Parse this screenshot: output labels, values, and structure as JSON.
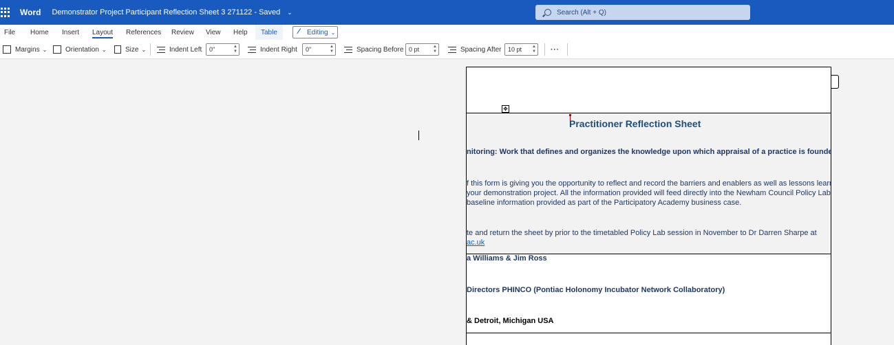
{
  "titlebar": {
    "app_name": "Word",
    "document_title": "Demonstrator Project Participant Reflection Sheet 3 271122",
    "save_status": "Saved",
    "search_placeholder": "Search (Alt + Q)"
  },
  "tabs": [
    {
      "label": "File"
    },
    {
      "label": "Home"
    },
    {
      "label": "Insert"
    },
    {
      "label": "Layout",
      "active": true
    },
    {
      "label": "References"
    },
    {
      "label": "Review"
    },
    {
      "label": "View"
    },
    {
      "label": "Help"
    },
    {
      "label": "Table",
      "contextual": true
    }
  ],
  "mode_button": {
    "label": "Editing"
  },
  "toolbar": {
    "margins_label": "Margins",
    "orientation_label": "Orientation",
    "size_label": "Size",
    "indent_left_label": "Indent Left",
    "indent_left_value": "0\"",
    "indent_right_label": "Indent Right",
    "indent_right_value": "0\"",
    "spacing_before_label": "Spacing Before",
    "spacing_before_value": "0 pt",
    "spacing_after_label": "Spacing After",
    "spacing_after_value": "10 pt",
    "more_label": "···"
  },
  "document": {
    "sheet_title": "Practitioner Reflection Sheet",
    "monitoring_line": "nitoring: Work that defines and organizes the knowledge upon which appraisal of a practice is founded",
    "intro_lines": [
      "f this form is giving you the opportunity to reflect and record the barriers and enablers as well as lessons learnt in",
      "your demonstration project. All the information provided will feed directly into the Newham Council Policy Lab and",
      "baseline information provided as part of the Participatory Academy business case."
    ],
    "return_line": "te and return the sheet by prior to the timetabled Policy Lab session in November to Dr Darren Sharpe at",
    "email_fragment": "ac.uk",
    "names_line": "a Williams & Jim Ross",
    "directors_line": "Directors PHINCO (Pontiac Holonomy Incubator Network Collaboratory)",
    "location_line": "& Detroit, Michigan USA"
  },
  "colors": {
    "titlebar": "#185abd",
    "heading_text": "#1f4e79",
    "body_text": "#1f3864",
    "link": "#0563c1"
  }
}
